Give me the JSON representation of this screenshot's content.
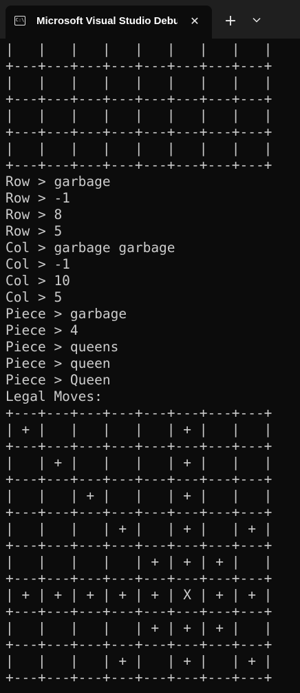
{
  "window": {
    "tab_title": "Microsoft Visual Studio Debug Console",
    "icon": "console-app-icon",
    "icon_glyph": "C:\\",
    "close_glyph": "✕",
    "new_tab_glyph": "+",
    "dropdown_icon": "chevron-down-icon"
  },
  "colors": {
    "background": "#0c0c0c",
    "tabbar": "#1f1f1f",
    "text": "#cccccc"
  },
  "console": {
    "lines": [
      "|   |   |   |   |   |   |   |   |",
      "+---+---+---+---+---+---+---+---+",
      "|   |   |   |   |   |   |   |   |",
      "+---+---+---+---+---+---+---+---+",
      "|   |   |   |   |   |   |   |   |",
      "+---+---+---+---+---+---+---+---+",
      "|   |   |   |   |   |   |   |   |",
      "+---+---+---+---+---+---+---+---+",
      "Row > garbage",
      "Row > -1",
      "Row > 8",
      "Row > 5",
      "Col > garbage garbage",
      "Col > -1",
      "Col > 10",
      "Col > 5",
      "Piece > garbage",
      "Piece > 4",
      "Piece > queens",
      "Piece > queen",
      "Piece > Queen",
      "Legal Moves:",
      "+---+---+---+---+---+---+---+---+",
      "| + |   |   |   |   | + |   |   |",
      "+---+---+---+---+---+---+---+---+",
      "|   | + |   |   |   | + |   |   |",
      "+---+---+---+---+---+---+---+---+",
      "|   |   | + |   |   | + |   |   |",
      "+---+---+---+---+---+---+---+---+",
      "|   |   |   | + |   | + |   | + |",
      "+---+---+---+---+---+---+---+---+",
      "|   |   |   |   | + | + | + |   |",
      "+---+---+---+---+---+---+---+---+",
      "| + | + | + | + | + | X | + | + |",
      "+---+---+---+---+---+---+---+---+",
      "|   |   |   |   | + | + | + |   |",
      "+---+---+---+---+---+---+---+---+",
      "|   |   |   | + |   | + |   | + |",
      "+---+---+---+---+---+---+---+---+"
    ]
  }
}
